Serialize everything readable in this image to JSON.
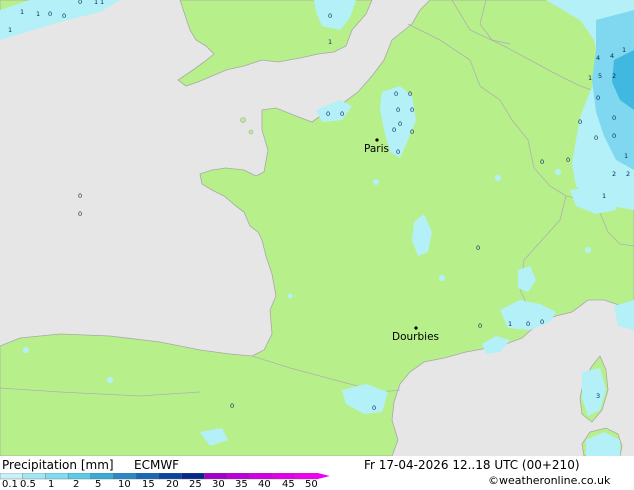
{
  "legend": {
    "title": "Precipitation [mm]",
    "model": "ECMWF",
    "ticks": [
      "0.1",
      "0.5",
      "1",
      "2",
      "5",
      "10",
      "15",
      "20",
      "25",
      "30",
      "35",
      "40",
      "45",
      "50"
    ],
    "colors": [
      "#c8f0f8",
      "#a0e6f4",
      "#80dcf0",
      "#5acbe8",
      "#3aaad6",
      "#2a88c8",
      "#1a66b8",
      "#0a44a0",
      "#06288a",
      "#a000c8",
      "#b800d8",
      "#d000e0",
      "#e000e8",
      "#f000f0"
    ]
  },
  "valid_time": "Fr 17-04-2026 12..18 UTC (00+210)",
  "credit": "©weatheronline.co.uk",
  "map": {
    "colors": {
      "sea": "#e6e6e6",
      "land": "#b7f08a",
      "precip_light": "#b4f0f8",
      "precip_mid": "#80d8f0",
      "precip_heavy": "#40b8e0",
      "border": "#b0b0b0",
      "coast": "#a8a8a8"
    },
    "cities": [
      {
        "name": "Paris"
      },
      {
        "name": "Dourbies"
      }
    ],
    "values": [
      "1",
      "1",
      "1",
      "0",
      "1",
      "0",
      "0",
      "0",
      "1",
      "0",
      "0",
      "0",
      "0",
      "0",
      "0",
      "0",
      "0",
      "0",
      "0",
      "1",
      "4",
      "4",
      "5",
      "2",
      "1",
      "1",
      "2",
      "2",
      "1",
      "0",
      "0",
      "0",
      "0",
      "0",
      "0",
      "1",
      "0",
      "1",
      "0",
      "0",
      "0",
      "0",
      "0",
      "0",
      "3",
      "0",
      "0"
    ]
  }
}
